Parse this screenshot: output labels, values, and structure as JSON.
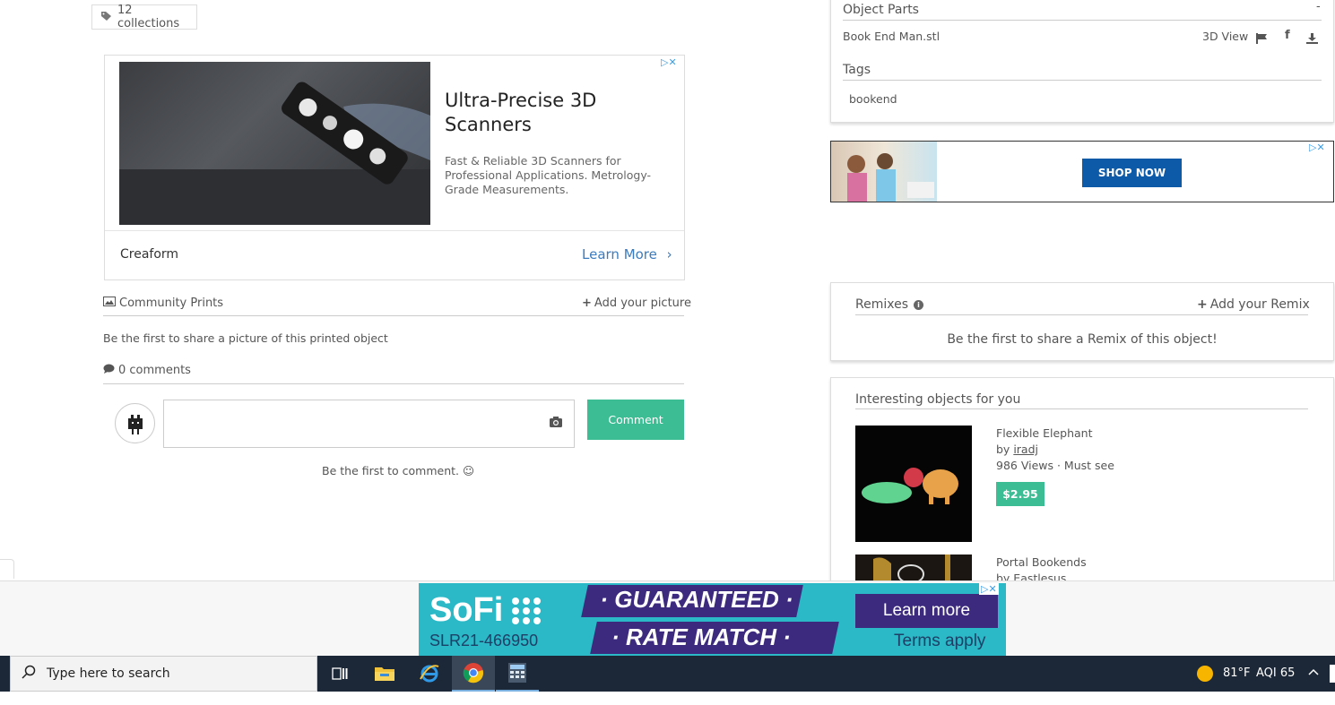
{
  "collections": {
    "label": "12 collections"
  },
  "ad1": {
    "title": "Ultra-Precise 3D Scanners",
    "description": "Fast & Reliable 3D Scanners for Professional Applications. Metrology-Grade Measurements.",
    "brand": "Creaform",
    "cta": "Learn More"
  },
  "community": {
    "title": "Community Prints",
    "add_label": "Add your picture",
    "empty": "Be the first to share a picture of this printed object"
  },
  "comments": {
    "count_label": "0 comments",
    "button": "Comment",
    "empty": "Be the first to comment. ☺"
  },
  "object_parts": {
    "title": "Object Parts",
    "collapse": "-",
    "file": "Book End Man.stl",
    "view_label": "3D View"
  },
  "tags": {
    "title": "Tags",
    "items": [
      "bookend"
    ]
  },
  "ad2": {
    "cta": "SHOP NOW"
  },
  "remixes": {
    "title": "Remixes",
    "add_label": "Add your Remix",
    "empty": "Be the first to share a Remix of this object!"
  },
  "interesting": {
    "title": "Interesting objects for you",
    "items": [
      {
        "name": "Flexible Elephant",
        "by": "by ",
        "author": "iradj",
        "meta": "986 Views · Must see",
        "price": "$2.95"
      },
      {
        "name": "Portal Bookends",
        "by": "by Eastlesus"
      }
    ]
  },
  "sofi_ad": {
    "brand": "SoFi",
    "code": "SLR21-466950",
    "line1": "· GUARANTEED ·",
    "line2": "· RATE MATCH ·",
    "cta": "Learn more",
    "terms": "Terms apply"
  },
  "taskbar": {
    "search_placeholder": "Type here to search",
    "weather": "81°F",
    "aqi": "AQI 65"
  },
  "colors": {
    "accent_green": "#3dbd94",
    "link_blue": "#3b7bbf",
    "shop_blue": "#0d5ba8",
    "taskbar": "#1c2838"
  }
}
